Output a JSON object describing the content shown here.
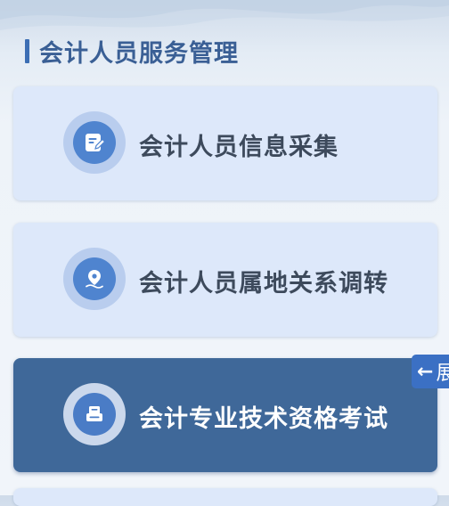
{
  "section": {
    "title": "会计人员服务管理"
  },
  "cards": [
    {
      "label": "会计人员信息采集",
      "icon": "edit-document-icon",
      "active": false
    },
    {
      "label": "会计人员属地关系调转",
      "icon": "location-pin-icon",
      "active": false
    },
    {
      "label": "会计专业技术资格考试",
      "icon": "printer-exam-icon",
      "active": true
    }
  ],
  "side_tab": {
    "arrow": "←",
    "label": "展"
  },
  "colors": {
    "accent": "#3c6eb4",
    "card_bg": "#dde8fa",
    "card_active_bg": "#3f6899",
    "title_text": "#3a5f95",
    "card_text": "#3d4a5c"
  }
}
